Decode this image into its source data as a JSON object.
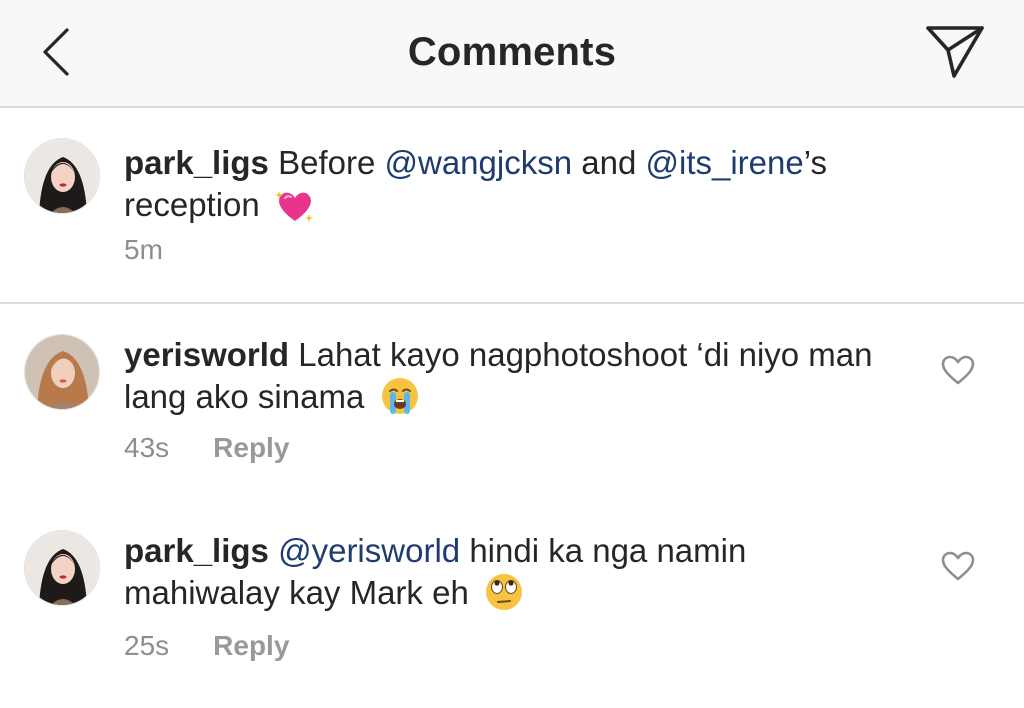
{
  "header": {
    "title": "Comments",
    "back_icon": "chevron-left-icon",
    "send_icon": "paper-plane-icon"
  },
  "caption": {
    "username": "park_ligs",
    "text_before": "Before",
    "mention1": "@wangjcksn",
    "text_and": "and",
    "mention2": "@its_irene",
    "text_after": "’s reception",
    "emoji": "sparkling-heart-emoji",
    "time": "5m"
  },
  "comments": [
    {
      "username": "yerisworld",
      "text": "Lahat kayo nagphotoshoot ‘di niyo man lang ako sinama",
      "emoji": "loudly-crying-face-emoji",
      "time": "43s",
      "reply_label": "Reply"
    },
    {
      "username": "park_ligs",
      "mention": "@yerisworld",
      "text": "hindi ka nga namin mahiwalay kay Mark eh",
      "emoji": "face-with-rolling-eyes-emoji",
      "time": "25s",
      "reply_label": "Reply"
    }
  ],
  "colors": {
    "mention": "#1f3c70",
    "meta": "#8e8e8e",
    "divider": "#dbdbdb",
    "header_bg": "#f8f8f8"
  }
}
